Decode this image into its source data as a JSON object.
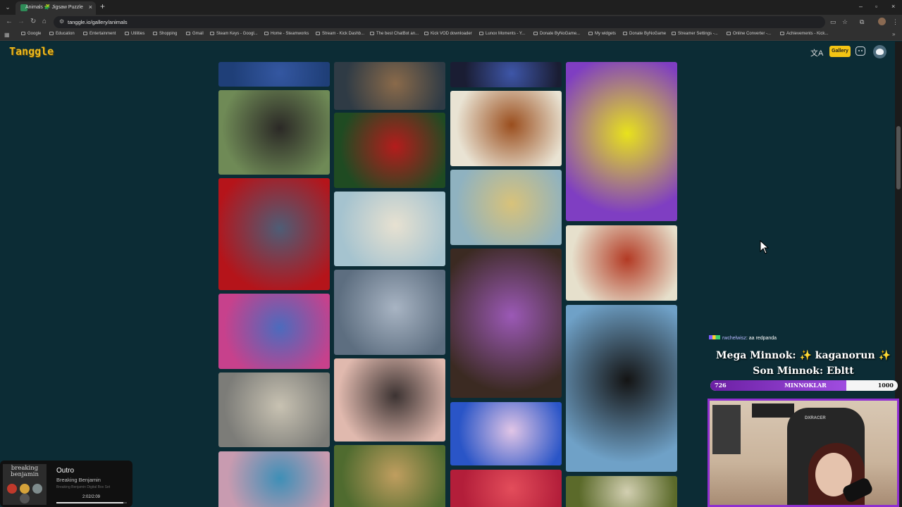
{
  "browser": {
    "tab_title": "Animals 🧩 Jigsaw Puzzle Galle",
    "url": "tanggle.io/gallery/animals",
    "bookmarks": [
      "Google",
      "Education",
      "Entertainment",
      "Utilities",
      "Shopping",
      "Gmail",
      "Steam Keys - Googl...",
      "Home - Steamworks",
      "Stream - Kick Dashb...",
      "The best ChatBot an...",
      "Kick VOD downloader",
      "Lunox Moments - Y...",
      "Donate ByNoGame...",
      "My widgets",
      "Donate ByNoGame",
      "Streamer Settings -...",
      "Online Converter -...",
      "Achievements - Kick..."
    ]
  },
  "site": {
    "logo": "Tanggle",
    "gallery_label": "Gallery",
    "translate_glyph": "文A",
    "gallery_category": "animals"
  },
  "colors": {
    "page_bg": "#0c2c35",
    "accent": "#f3c414",
    "logo": "#e9b820",
    "goal_purple": "#8f2fd0"
  },
  "music": {
    "album_art_text": "breaking benjamin",
    "song": "Outro",
    "artist": "Breaking Benjamin",
    "album": "Breaking Benjamin Digital Box Set",
    "time": "2:02/2:09",
    "progress_fraction": 0.946
  },
  "chat": {
    "user": "rwchelwisz",
    "message": ": aa redpanda"
  },
  "overlay": {
    "mega_line": "Mega Minnok: ✨ kaganorun ✨",
    "son_line": "Son Minnok: Ebltt",
    "goal_current": "726",
    "goal_label": "MINNOKLAR",
    "goal_max": "1000",
    "goal_fraction": 0.726,
    "chair_brand": "DXRACER"
  },
  "puzzles": [
    {
      "name": "underwater-blue",
      "colors": [
        "#1f3f78",
        "#3457a1"
      ]
    },
    {
      "name": "dog-on-cushion",
      "colors": [
        "#6f8a56",
        "#2b2926"
      ]
    },
    {
      "name": "cat-in-red-blanket",
      "colors": [
        "#b5141a",
        "#4e5d76"
      ]
    },
    {
      "name": "pink-tiger-graffiti",
      "colors": [
        "#c7418c",
        "#4c6bbd"
      ]
    },
    {
      "name": "snow-leopard",
      "colors": [
        "#7c7c78",
        "#c8c2b2"
      ]
    },
    {
      "name": "sea-turtle-painting",
      "colors": [
        "#c89bb0",
        "#3e8fb7"
      ]
    },
    {
      "name": "dog-at-water",
      "colors": [
        "#2f3b45",
        "#8a6a4a"
      ]
    },
    {
      "name": "christmas-puppy",
      "colors": [
        "#1f4b22",
        "#b41c1c"
      ]
    },
    {
      "name": "sleeping-puppy",
      "colors": [
        "#a5c3cf",
        "#e7e1d1"
      ]
    },
    {
      "name": "polar-bear",
      "colors": [
        "#5d6e80",
        "#a8b4c3"
      ]
    },
    {
      "name": "beach-sunset",
      "colors": [
        "#e0b9ae",
        "#3c3332"
      ]
    },
    {
      "name": "leopard-in-tree",
      "colors": [
        "#4f6b2f",
        "#c09e5f"
      ]
    },
    {
      "name": "snake-scales",
      "colors": [
        "#1a1d33",
        "#3e56a8"
      ]
    },
    {
      "name": "butterfly-collection",
      "colors": [
        "#e9e3d3",
        "#9a4e1e"
      ]
    },
    {
      "name": "insect-collection",
      "colors": [
        "#8fb2c0",
        "#d8c27a"
      ]
    },
    {
      "name": "crafts-still-life",
      "colors": [
        "#3b2a22",
        "#9b59b6"
      ]
    },
    {
      "name": "swimming-turtle",
      "colors": [
        "#2a55c7",
        "#e1c5e6"
      ]
    },
    {
      "name": "red-petals",
      "colors": [
        "#b31e3a",
        "#e34d5b"
      ]
    },
    {
      "name": "green-frog-on-flower",
      "colors": [
        "#7f3ec2",
        "#e8e21c"
      ]
    },
    {
      "name": "beetle-collection",
      "colors": [
        "#e6e0cc",
        "#b33a24"
      ]
    },
    {
      "name": "horse-at-sea",
      "colors": [
        "#6fa1c7",
        "#141414"
      ]
    },
    {
      "name": "autumn-forest",
      "colors": [
        "#5b6a2a",
        "#d2cfb1"
      ]
    }
  ]
}
